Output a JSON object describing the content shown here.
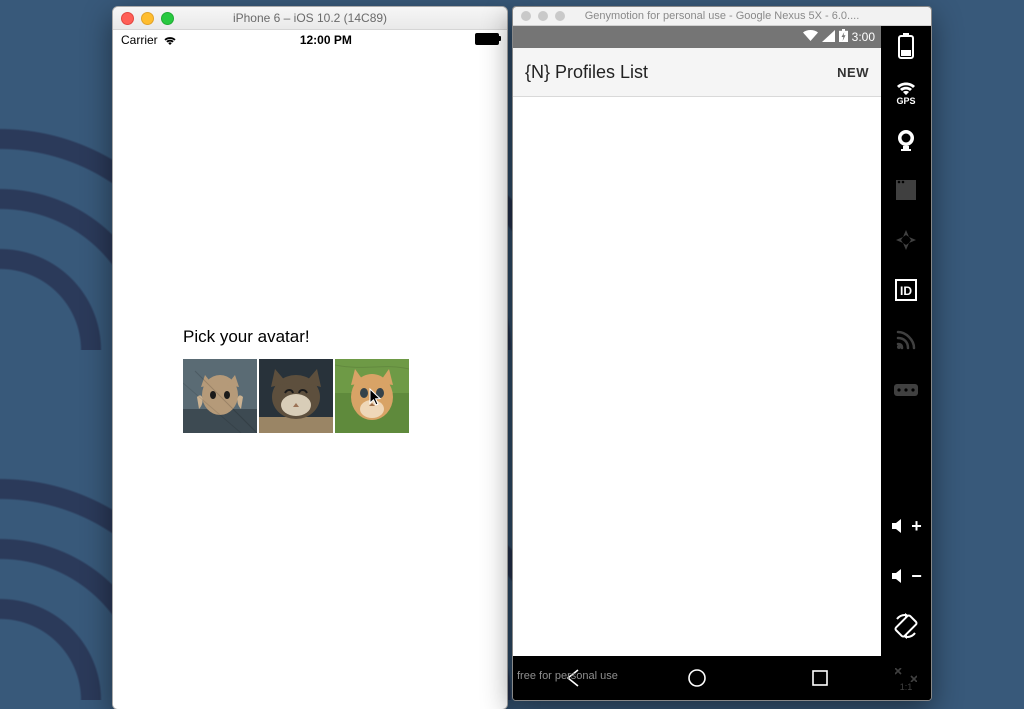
{
  "ios": {
    "window_title": "iPhone 6 – iOS 10.2 (14C89)",
    "carrier": "Carrier",
    "clock": "12:00 PM",
    "content": {
      "heading": "Pick your avatar!"
    }
  },
  "geny": {
    "window_title": "Genymotion for personal use - Google Nexus 5X - 6.0....",
    "android_clock": "3:00",
    "app_title": "{N} Profiles List",
    "app_action": "NEW",
    "watermark": "free for personal use",
    "sidebar": {
      "gps_label": "GPS",
      "id_label": "ID",
      "one_to_one": "1:1"
    }
  }
}
